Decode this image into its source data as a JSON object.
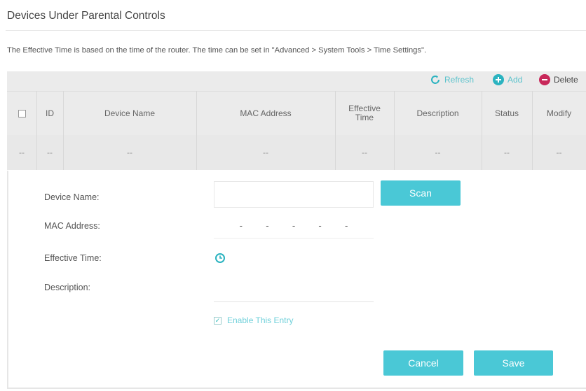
{
  "page": {
    "title": "Devices Under Parental Controls",
    "note": "The Effective Time is based on the time of the router. The time can be set in \"Advanced > System Tools > Time Settings\"."
  },
  "toolbar": {
    "refresh_label": "Refresh",
    "add_label": "Add",
    "delete_label": "Delete"
  },
  "table": {
    "columns": [
      "ID",
      "Device Name",
      "MAC Address",
      "Effective Time",
      "Description",
      "Status",
      "Modify"
    ],
    "rows": [
      [
        "--",
        "--",
        "--",
        "--",
        "--",
        "--",
        "--",
        "--"
      ]
    ]
  },
  "form": {
    "device_name_label": "Device Name:",
    "device_name_value": "",
    "scan_label": "Scan",
    "mac_label": "MAC Address:",
    "mac_separator": "-",
    "effective_time_label": "Effective Time:",
    "description_label": "Description:",
    "description_value": "",
    "enable_label": "Enable This Entry",
    "enable_checked": true,
    "cancel_label": "Cancel",
    "save_label": "Save"
  },
  "colors": {
    "accent": "#4ac8d6",
    "refresh_icon": "#2bb3c0",
    "add_icon": "#2bb3c0",
    "delete_icon": "#c8285a"
  },
  "icons": {
    "refresh": "refresh-icon",
    "add": "plus-circle-icon",
    "delete": "minus-circle-icon",
    "clock": "clock-icon"
  }
}
